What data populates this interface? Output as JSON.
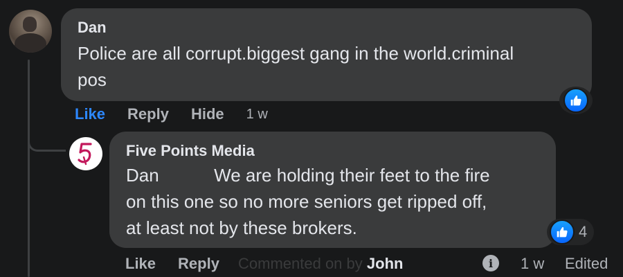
{
  "comment": {
    "author": "Dan",
    "text": "Police are all corrupt.biggest gang in the world.criminal\npos",
    "actions": {
      "like": "Like",
      "reply": "Reply",
      "hide": "Hide",
      "time": "1 w"
    },
    "reaction": {
      "type": "like-icon"
    }
  },
  "reply": {
    "author": "Five Points Media",
    "mention": "Dan",
    "text": "We are holding their feet to the fire\non this one so no more seniors get ripped off,\nat least not by these brokers.",
    "actions": {
      "like": "Like",
      "reply": "Reply"
    },
    "commented_by_label": "Commented on by",
    "commented_by_name": "John",
    "info_symbol": "i",
    "time": "1 w",
    "edited": "Edited",
    "reaction": {
      "type": "like-icon",
      "count": "4"
    }
  },
  "colors": {
    "background": "#18191a",
    "bubble": "#3a3b3c",
    "text": "#e4e6eb",
    "muted": "#b0b3b8",
    "accent": "#2d88ff"
  }
}
